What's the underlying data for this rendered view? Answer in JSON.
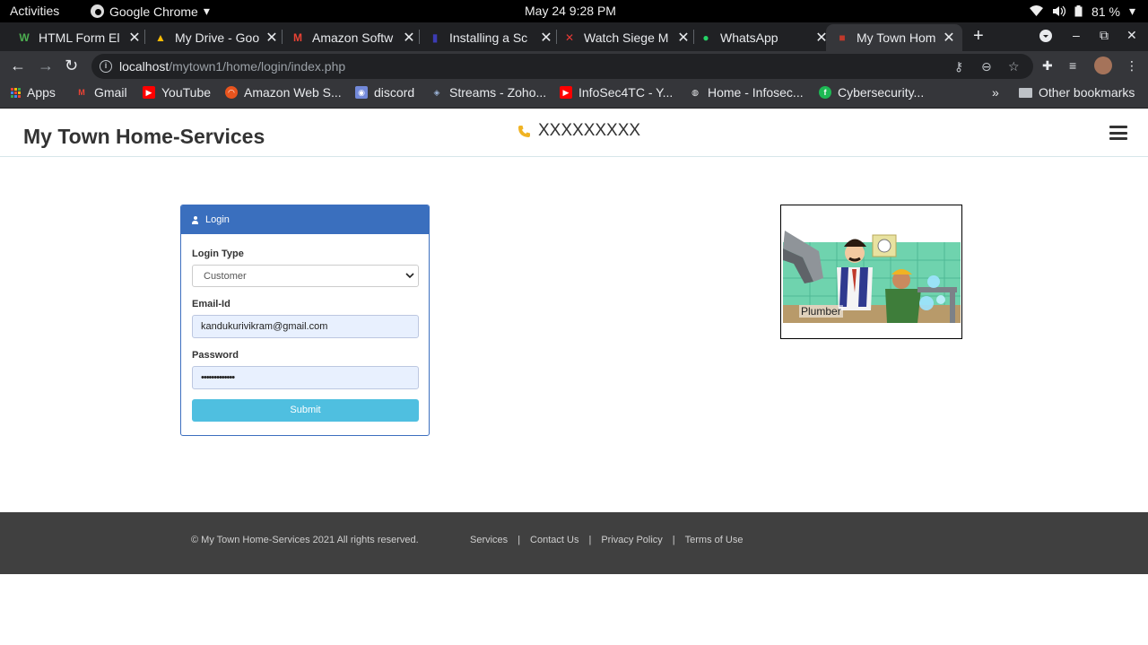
{
  "system_bar": {
    "activities": "Activities",
    "app_name": "Google Chrome",
    "app_caret": "▾",
    "clock": "May 24  9:28 PM",
    "battery": "81 %",
    "status_caret": "▾"
  },
  "tabs": [
    {
      "title": "HTML Form El",
      "favicon": "W",
      "color": "#4caf50"
    },
    {
      "title": "My Drive - Goo",
      "favicon": "▲",
      "color": "#fbbc04"
    },
    {
      "title": "Amazon Softw",
      "favicon": "M",
      "color": "#ea4335"
    },
    {
      "title": "Installing a Sc",
      "favicon": "▮",
      "color": "#3c3cb4"
    },
    {
      "title": "Watch Siege M",
      "favicon": "✕",
      "color": "#e53935"
    },
    {
      "title": "WhatsApp",
      "favicon": "●",
      "color": "#25d366"
    },
    {
      "title": "My Town Hom",
      "favicon": "■",
      "color": "#c0392b"
    }
  ],
  "browser": {
    "new_tab": "+",
    "minimize": "‒",
    "restore": "⧉",
    "close": "✕",
    "back": "←",
    "forward": "→",
    "reload": "↻",
    "url_host": "localhost",
    "url_path": "/mytown1/home/login/index.php",
    "info": "i",
    "key_icon": "⚷",
    "zoom_icon": "⊖",
    "star_icon": "☆",
    "puzzle_icon": "✚",
    "media_icon": "≡",
    "menu_icon": "⋮"
  },
  "bookmarks": [
    {
      "label": "Apps"
    },
    {
      "label": "Gmail",
      "favicon": "M",
      "color": "#ea4335"
    },
    {
      "label": "YouTube",
      "favicon": "▶",
      "color": "#ff0000"
    },
    {
      "label": "Amazon Web S...",
      "favicon": "◠",
      "color": "#e8541e"
    },
    {
      "label": "discord",
      "favicon": "◉",
      "color": "#7289da"
    },
    {
      "label": "Streams - Zoho...",
      "favicon": "◈",
      "color": "#9cb4d8"
    },
    {
      "label": "InfoSec4TC - Y...",
      "favicon": "▶",
      "color": "#ff0000"
    },
    {
      "label": "Home - Infosec...",
      "favicon": "◍",
      "color": "#e8eaed"
    },
    {
      "label": "Cybersecurity...",
      "favicon": "f",
      "color": "#1db954"
    }
  ],
  "bookmarks_overflow": "»",
  "other_bookmarks": "Other bookmarks",
  "site": {
    "brand": "My Town Home-Services",
    "phone": "XXXXXXXXX"
  },
  "login": {
    "header": "Login",
    "login_type_label": "Login Type",
    "login_type_value": "Customer",
    "email_label": "Email-Id",
    "email_value": "kandukurivikram@gmail.com",
    "password_label": "Password",
    "password_value": "•••••••••••••",
    "submit": "Submit"
  },
  "service": {
    "caption": "Plumber"
  },
  "footer": {
    "copyright": "© My Town Home-Services 2021 All rights reserved.",
    "links": [
      "Services",
      "Contact Us",
      "Privacy Policy",
      "Terms of Use"
    ],
    "separator": "|"
  }
}
